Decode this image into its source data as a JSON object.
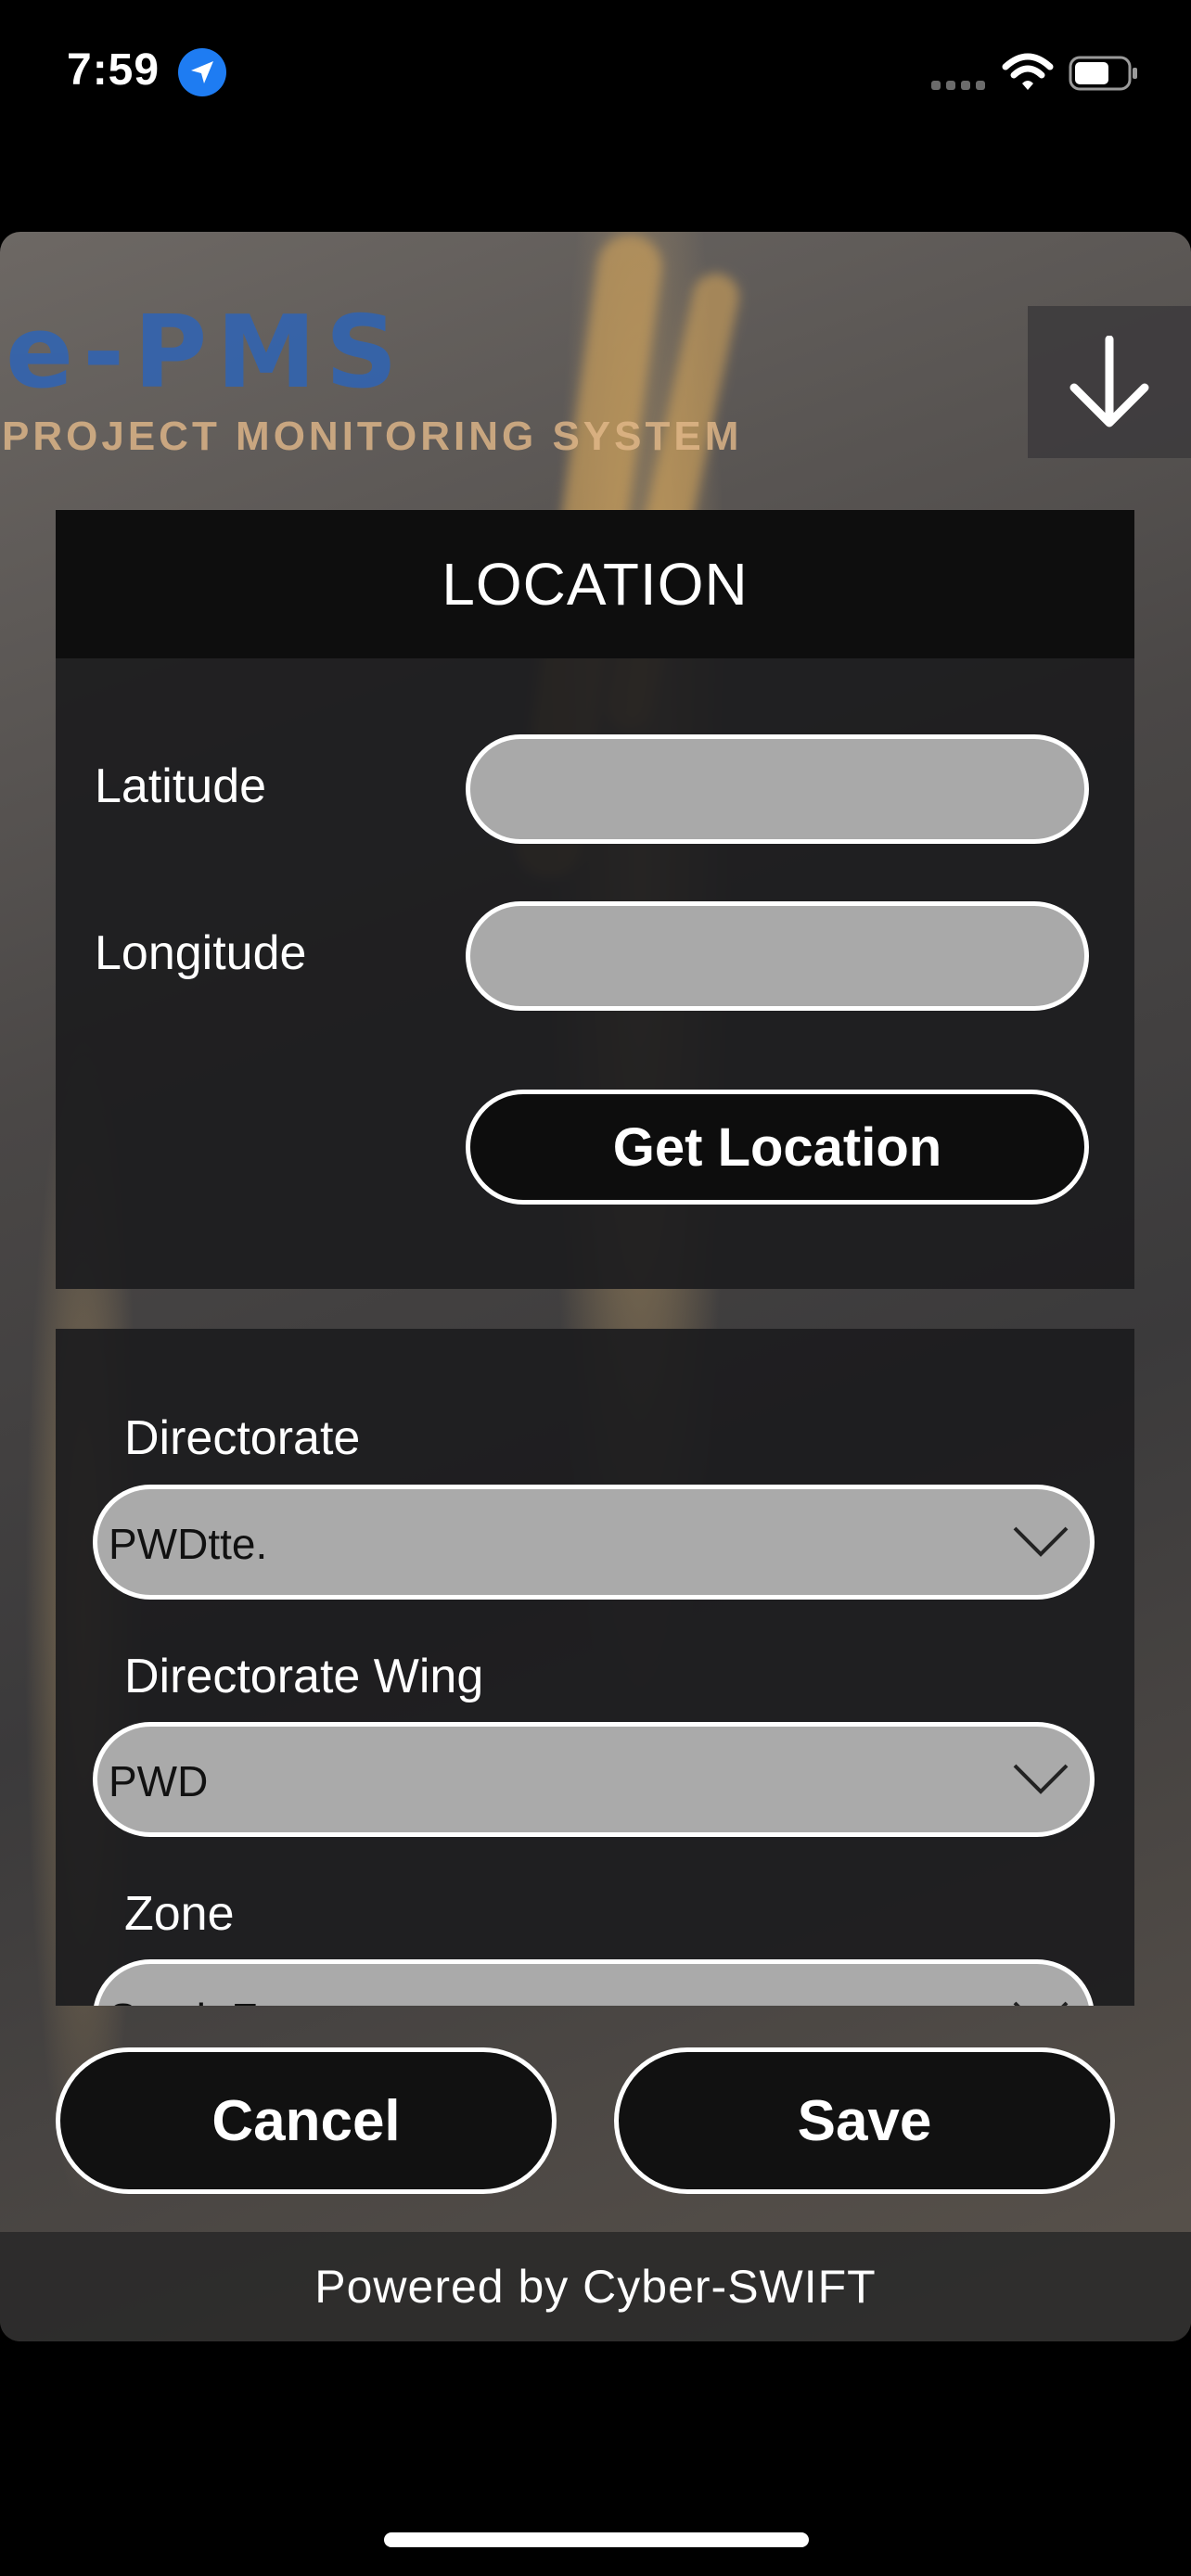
{
  "status_bar": {
    "time": "7:59",
    "location_icon": "location-arrow-icon",
    "wifi_icon": "wifi-icon",
    "battery_icon": "battery-icon"
  },
  "header": {
    "brand": "e-PMS",
    "tagline": "PROJECT MONITORING SYSTEM",
    "download_icon": "arrow-down-icon"
  },
  "location_panel": {
    "title": "LOCATION",
    "latitude_label": "Latitude",
    "latitude_value": "",
    "longitude_label": "Longitude",
    "longitude_value": "",
    "get_location_label": "Get Location"
  },
  "form": {
    "directorate": {
      "label": "Directorate",
      "value": "PWDtte."
    },
    "directorate_wing": {
      "label": "Directorate Wing",
      "value": "PWD"
    },
    "zone": {
      "label": "Zone",
      "value": "South Z"
    }
  },
  "actions": {
    "cancel_label": "Cancel",
    "save_label": "Save"
  },
  "footer": {
    "text": "Powered by Cyber-SWIFT"
  },
  "colors": {
    "accent_blue": "#1e7cf2",
    "brand_blue": "#2f64b5",
    "input_gray": "#a9a9a9",
    "panel_dark": "#1c1c1e"
  }
}
